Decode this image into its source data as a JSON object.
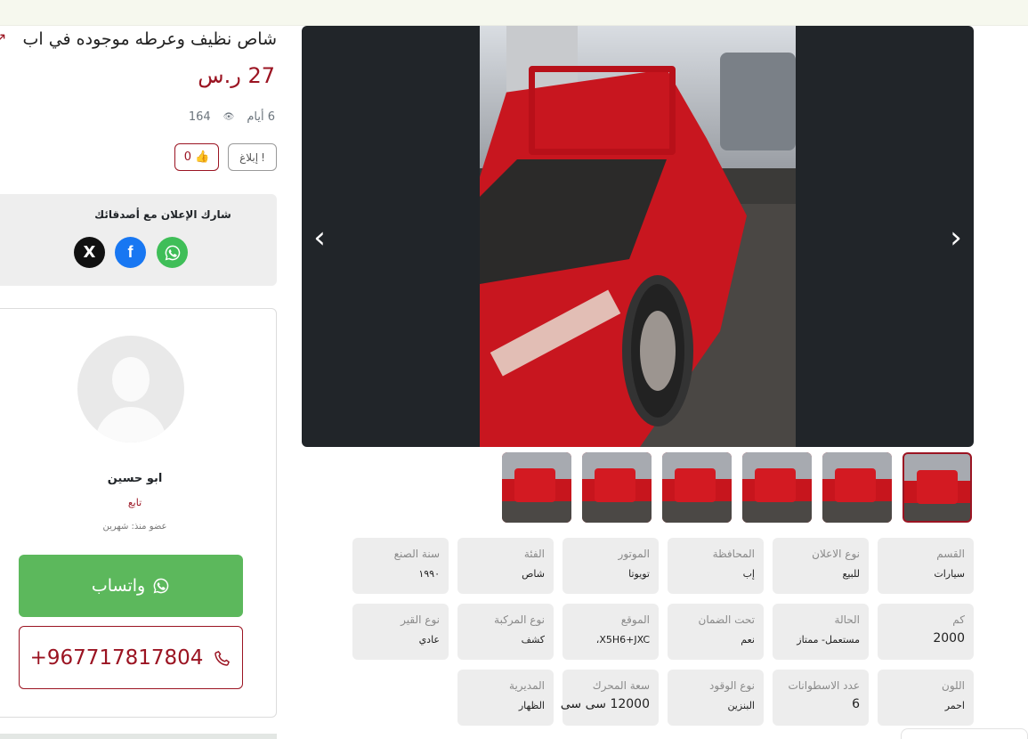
{
  "listing": {
    "title": "شاص نظيف وعرطه موجوده في اب",
    "price": "27 ر.س",
    "age": "6 أيام",
    "views": "164",
    "report_label": "إبلاغ",
    "likes": "0"
  },
  "share": {
    "title": "شارك الإعلان مع أصدقائك",
    "x_label": "X",
    "fb_label": "f"
  },
  "seller": {
    "name": "ابو حسين",
    "follow_label": "تابع",
    "member_since": "عضو منذ: شهرين",
    "whatsapp_label": "واتساب",
    "phone": "+967717817804"
  },
  "gallery": {
    "prev_glyph": "‹",
    "next_glyph": "›",
    "thumb_count": 6,
    "active_thumb": 1
  },
  "specs": [
    {
      "label": "القسم",
      "value": "سيارات"
    },
    {
      "label": "نوع الاعلان",
      "value": "للبيع"
    },
    {
      "label": "المحافظة",
      "value": "إب"
    },
    {
      "label": "الموتور",
      "value": "تويوتا"
    },
    {
      "label": "الفئة",
      "value": "شاص"
    },
    {
      "label": "سنة الصنع",
      "value": "١٩٩٠"
    },
    {
      "label": "كم",
      "value": "2000"
    },
    {
      "label": "الحالة",
      "value": "مستعمل- ممتاز"
    },
    {
      "label": "تحت الضمان",
      "value": "نعم"
    },
    {
      "label": "الموقع",
      "value": "X5H6+JXC،"
    },
    {
      "label": "نوع المركبة",
      "value": "كشف"
    },
    {
      "label": "نوع القير",
      "value": "عادي"
    },
    {
      "label": "اللون",
      "value": "احمر"
    },
    {
      "label": "عدد الاسطوانات",
      "value": "6"
    },
    {
      "label": "نوع الوقود",
      "value": "البنزين"
    },
    {
      "label": "سعة المحرك",
      "value": "12000 سی سی"
    },
    {
      "label": "المديرية",
      "value": "الظهار"
    }
  ],
  "colors": {
    "brand": "#9b1422",
    "whatsapp": "#5cb85c",
    "facebook": "#1877f2"
  }
}
